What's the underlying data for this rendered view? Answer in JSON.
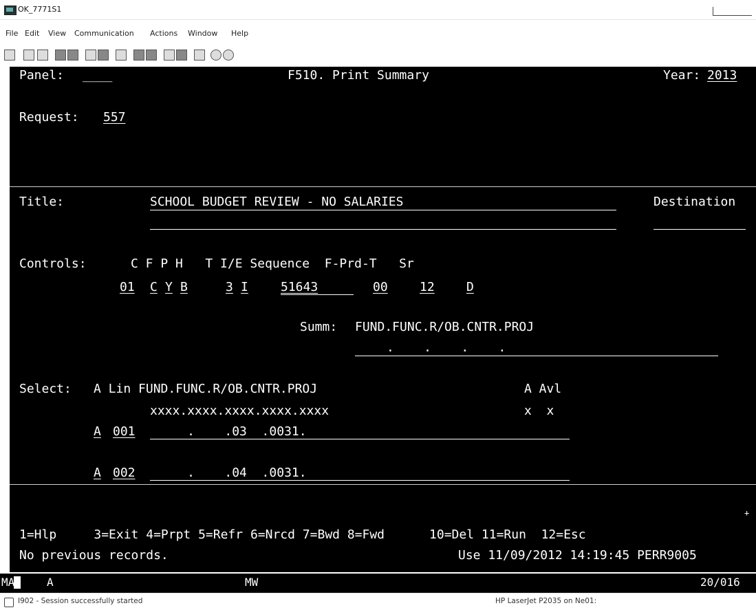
{
  "window": {
    "title": "OK_7771S1"
  },
  "menu": [
    "File",
    "Edit",
    "View",
    "Communication",
    "Actions",
    "Window",
    "Help"
  ],
  "toolbar": [
    "print-icon",
    "copy-icon",
    "paste-icon",
    "send-icon",
    "receive-icon",
    "display-icon",
    "keyboard-icon",
    "chart-icon",
    "macro-record-icon",
    "macro-play-icon",
    "transfer-send-icon",
    "transfer-receive-icon",
    "exit-icon",
    "globe-icon",
    "link-icon"
  ],
  "screen": {
    "panel_label": "Panel:",
    "panel_value": "____",
    "screen_title": "F510. Print Summary",
    "year_label": "Year:",
    "year_value": "2013",
    "request_label": "Request:",
    "request_value": "557",
    "title_label": "Title:",
    "title_value": "SCHOOL BUDGET REVIEW - NO SALARIES",
    "destination_label": "Destination",
    "controls_label": "Controls:",
    "controls_header": "C F P H   T I/E Sequence  F-Prd-T   Sr",
    "controls": {
      "c": "01",
      "f": "C",
      "p": "Y",
      "h": "B",
      "t": "3",
      "ie": "I",
      "sequence": "51643",
      "f_prd": "00",
      "t_prd": "12",
      "sr": "D"
    },
    "summ_label": "Summ:",
    "summ_value": "FUND.FUNC.R/OB.CNTR.PROJ",
    "summ_dots": ".    .    .    .",
    "select_label": "Select:",
    "select_header": "A Lin FUND.FUNC.R/OB.CNTR.PROJ",
    "select_header_right": "A Avl",
    "select_mask": "xxxx.xxxx.xxxx.xxxx.xxxx",
    "select_mask_right": "x  x",
    "lines": [
      {
        "a": "A",
        "lin": "001",
        "fields": "     .    .03  .0031."
      },
      {
        "a": "A",
        "lin": "002",
        "fields": "     .    .04  .0031."
      }
    ],
    "plus": "+",
    "fkeys": "1=Hlp     3=Exit 4=Prpt 5=Refr 6=Nrcd 7=Bwd 8=Fwd      10=Del 11=Run  12=Esc",
    "message": "No previous records.",
    "info": "Use 11/09/2012 14:19:45 PERR9005",
    "oia": {
      "ma": "MA",
      "a": "A",
      "mw": "MW",
      "pos": "20/016"
    }
  },
  "status": {
    "left": "I902 - Session successfully started",
    "right": "HP LaserJet P2035 on Ne01:"
  }
}
